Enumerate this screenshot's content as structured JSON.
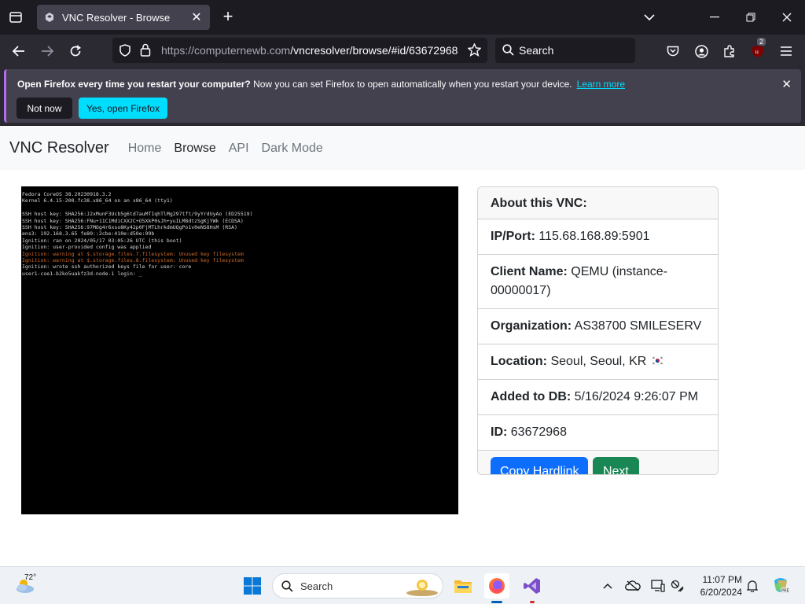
{
  "browser": {
    "tab_title": "VNC Resolver - Browse",
    "url_host": "https://computernewb.com",
    "url_path": "/vncresolver/browse/#id/63672968",
    "search_placeholder": "Search",
    "extension_badge": "2"
  },
  "notification": {
    "bold_text": "Open Firefox every time you restart your computer?",
    "text": " Now you can set Firefox to open automatically when you restart your device.",
    "link": "Learn more",
    "btn_not_now": "Not now",
    "btn_yes": "Yes, open Firefox"
  },
  "site": {
    "brand": "VNC Resolver",
    "nav": [
      "Home",
      "Browse",
      "API",
      "Dark Mode"
    ],
    "active_nav": "Browse"
  },
  "terminal_lines": [
    {
      "text": "Fedora CoreOS 38.20230918.3.2",
      "color": "white"
    },
    {
      "text": "Kernel 6.4.15-200.fc38.x86_64 on an x86_64 (tty1)",
      "color": "white"
    },
    {
      "text": "",
      "color": "white"
    },
    {
      "text": "SSH host key: SHA256:J2xMunF3Ucb5g6td7auMTIqhTlMg297tft/9yYrdUyAo (ED25519)",
      "color": "white"
    },
    {
      "text": "SSH host key: SHA256:FNu+11C1MdiCXX2C+O5XkP0sJh+yuILM8dtzSgKjYWk (ECDSA)",
      "color": "white"
    },
    {
      "text": "SSH host key: SHA256:97MOg4r6xso8Ky42p0FjMTLhrkdmUQgPo1v0eNS8HsM (RSA)",
      "color": "white"
    },
    {
      "text": "ens3: 192.168.3.65 fe80::2cbe:410e:d50e:99b",
      "color": "white"
    },
    {
      "text": "Ignition: ran on 2024/05/17 03:05:26 UTC (this boot)",
      "color": "white"
    },
    {
      "text": "Ignition: user-provided config was applied",
      "color": "white"
    },
    {
      "text": "Ignition: warning at $.storage.files.7.filesystem: Unused key filesystem",
      "color": "orange"
    },
    {
      "text": "Ignition: warning at $.storage.files.8.filesystem: Unused key filesystem",
      "color": "orange"
    },
    {
      "text": "Ignition: wrote ssh authorized keys file for user: core",
      "color": "white"
    },
    {
      "text": "user1-coe1-b2ko5uakfz3d-node-1 login: _",
      "color": "white"
    }
  ],
  "card": {
    "header": "About this VNC:",
    "ip_label": "IP/Port:",
    "ip_value": " 115.68.168.89:5901",
    "client_label": "Client Name:",
    "client_value": " QEMU (instance-00000017)",
    "org_label": "Organization:",
    "org_value": " AS38700 SMILESERV",
    "loc_label": "Location:",
    "loc_value": " Seoul, Seoul, KR",
    "added_label": "Added to DB:",
    "added_value": " 5/16/2024 9:26:07 PM",
    "id_label": "ID:",
    "id_value": " 63672968",
    "btn_copy": "Copy Hardlink",
    "btn_next": "Next"
  },
  "taskbar": {
    "temperature": "72°",
    "search_label": "Search",
    "time": "11:07 PM",
    "date": "6/20/2024"
  }
}
